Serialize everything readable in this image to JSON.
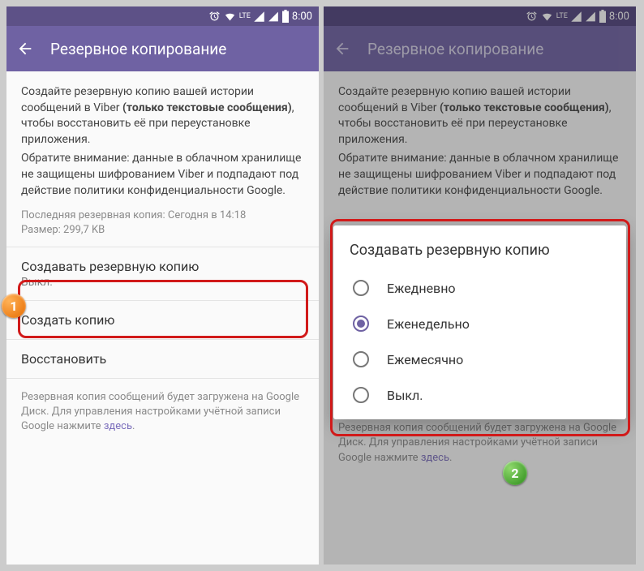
{
  "status": {
    "time": "8:00",
    "lte": "LTE"
  },
  "header": {
    "title": "Резервное копирование"
  },
  "body": {
    "p1a": "Создайте резервную копию вашей истории сообщений в Viber ",
    "p1b": "(только текстовые сообщения)",
    "p1c": ", чтобы восстановить её при переустановке приложения.",
    "p2": "Обратите внимание: данные в облачном хранилище не защищены шифрованием Viber и подпадают под действие политики конфиденциальности Google.",
    "meta1": "Последняя резервная копия: Сегодня в 14:18",
    "meta2": "Размер: 299,7 KB"
  },
  "items": {
    "auto": {
      "title": "Создавать резервную копию",
      "sub": "Выкл."
    },
    "backup": {
      "title": "Создать копию"
    },
    "restore": {
      "title": "Восстановить"
    }
  },
  "footer": {
    "text": "Резервная копия сообщений будет загружена на Google Диск. Для управления настройками учётной записи Google нажмите ",
    "link": "здесь",
    "dot": "."
  },
  "dialog": {
    "title": "Создавать резервную копию",
    "opt1": "Ежедневно",
    "opt2": "Еженедельно",
    "opt3": "Ежемесячно",
    "opt4": "Выкл."
  },
  "badges": {
    "one": "1",
    "two": "2"
  }
}
